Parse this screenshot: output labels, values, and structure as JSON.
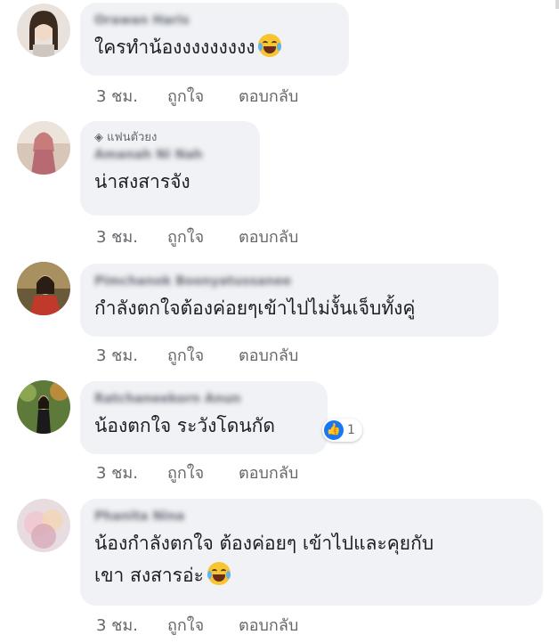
{
  "colors": {
    "bubble": "#f0f2f5",
    "text": "#1c1e21",
    "meta": "#65676b",
    "like_blue": "#1877f2"
  },
  "comments": [
    {
      "author": "Orawan Haris",
      "text": "ใครทำน้องงงงงงงงง",
      "emoji": "laughing-tears-emoji",
      "time": "3 ชม.",
      "like": "ถูกใจ",
      "reply": "ตอบกลับ"
    },
    {
      "badge": "แฟนตัวยง",
      "badge_icon": "diamond-icon",
      "author": "Amanah Ni Nah",
      "text": "น่าสงสารจัง",
      "time": "3 ชม.",
      "like": "ถูกใจ",
      "reply": "ตอบกลับ"
    },
    {
      "author": "Pimchanok Boonyatussanee",
      "text": "กำลังตกใจต้องค่อยๆเข้าไปไม่งั้นเจ็บทั้งคู่",
      "time": "3 ชม.",
      "like": "ถูกใจ",
      "reply": "ตอบกลับ"
    },
    {
      "author": "Ratchaneekorn Anun",
      "text": "น้องตกใจ ระวังโดนกัด",
      "reaction_count": "1",
      "time": "3 ชม.",
      "like": "ถูกใจ",
      "reply": "ตอบกลับ"
    },
    {
      "author": "Phanita Nina",
      "text_line1": "น้องกำลังตกใจ ต้องค่อยๆ เข้าไปและคุยกับ",
      "text_line2": "เขา สงสารอ่ะ",
      "emoji": "crying-emoji",
      "time": "3 ชม.",
      "like": "ถูกใจ",
      "reply": "ตอบกลับ"
    }
  ]
}
